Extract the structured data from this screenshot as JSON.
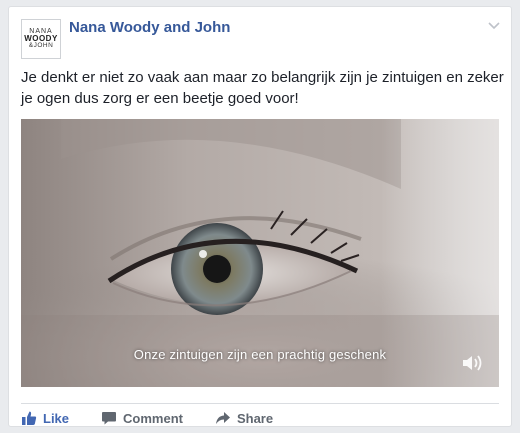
{
  "post": {
    "page_name": "Nana Woody and John",
    "avatar": {
      "line1": "NANA",
      "line2": "WOODY",
      "line3": "&JOHN"
    },
    "text": "Je denkt er niet zo vaak aan maar zo belangrijk zijn je zintuigen en zeker je ogen dus zorg er een beetje goed voor!",
    "menu_icon": "chevron-down-icon"
  },
  "video": {
    "subtitle": "Onze zintuigen zijn een prachtig geschenk",
    "sound_icon": "speaker-icon"
  },
  "actions": {
    "like": "Like",
    "comment": "Comment",
    "share": "Share"
  },
  "colors": {
    "page_name": "#365899",
    "like_accent": "#4267b2",
    "action_text": "#606770"
  }
}
